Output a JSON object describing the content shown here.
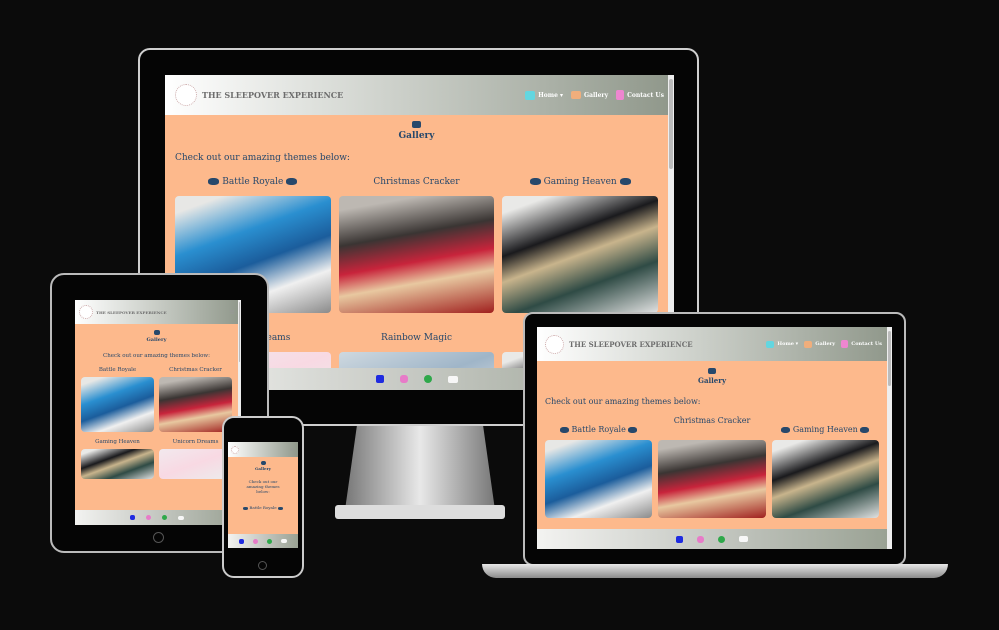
{
  "site": {
    "brand": "THE SLEEPOVER EXPERIENCE",
    "nav": {
      "home": "Home ▾",
      "gallery": "Gallery",
      "contact": "Contact Us"
    },
    "page_title": "Gallery",
    "intro": "Check out our amazing themes below:",
    "themes": [
      "Battle Royale",
      "Christmas Cracker",
      "Gaming Heaven",
      "Unicorn Dreams",
      "Rainbow Magic"
    ],
    "footer_icons": [
      "facebook-icon",
      "instagram-icon",
      "whatsapp-icon",
      "email-icon"
    ]
  },
  "colors": {
    "page_bg": "#fdb98c",
    "text": "#27486b",
    "facebook": "#1f2be0",
    "instagram": "#e77bc8",
    "whatsapp": "#2ea84a"
  }
}
